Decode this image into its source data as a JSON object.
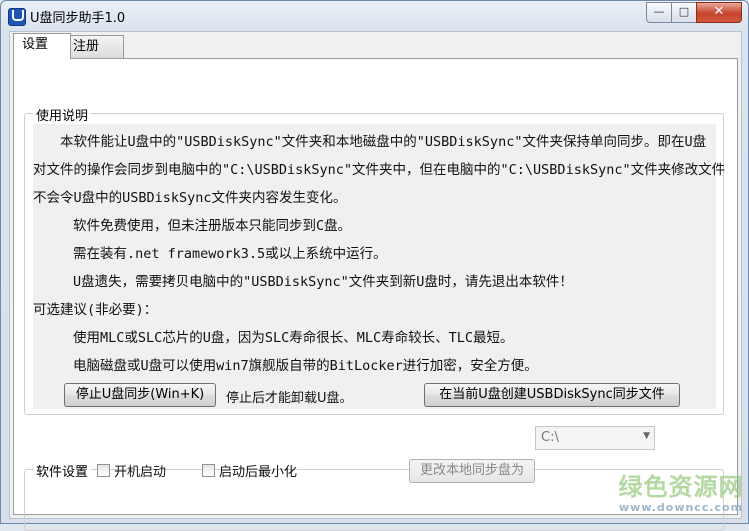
{
  "window": {
    "title": "U盘同步助手1.0",
    "controls": {
      "minimize": "—",
      "maximize": "□",
      "close": "✕"
    }
  },
  "tabs": [
    {
      "label": "设置",
      "active": true
    },
    {
      "label": "注册",
      "active": false
    }
  ],
  "usage": {
    "group_title": "使用说明",
    "lines": [
      "本软件能让U盘中的\"USBDiskSync\"文件夹和本地磁盘中的\"USBDiskSync\"文件夹保持单向同步。即在U盘",
      "对文件的操作会同步到电脑中的\"C:\\USBDiskSync\"文件夹中，但在电脑中的\"C:\\USBDiskSync\"文件夹修改文件",
      "不会令U盘中的USBDiskSync文件夹内容发生变化。",
      "软件免费使用，但未注册版本只能同步到C盘。",
      "需在装有.net framework3.5或以上系统中运行。",
      "U盘遗失，需要拷贝电脑中的\"USBDiskSync\"文件夹到新U盘时，请先退出本软件！",
      "可选建议(非必要)：",
      "使用MLC或SLC芯片的U盘，因为SLC寿命很长、MLC寿命较长、TLC最短。",
      "电脑磁盘或U盘可以使用win7旗舰版自带的BitLocker进行加密，安全方便。"
    ]
  },
  "actions": {
    "stop_sync_button": "停止U盘同步(Win+K)",
    "stop_hint": "停止后才能卸载U盘。",
    "create_sync_folder_button": "在当前U盘创建USBDiskSync同步文件"
  },
  "settings": {
    "group_title": "软件设置",
    "autostart_label": "开机启动",
    "autostart_checked": false,
    "minimize_label": "启动后最小化",
    "minimize_checked": false,
    "change_drive_button": "更改本地同步盘为",
    "drive_value": "C:\\"
  },
  "watermark": {
    "main": "绿色资源网",
    "sub": "www.downcc.com"
  },
  "colors": {
    "accent": "#1f56b6",
    "close": "#c5442c",
    "watermark": "#9ccc83"
  },
  "icons": {
    "app": "usb-drive-icon",
    "combo_arrow": "chevron-down-icon"
  }
}
